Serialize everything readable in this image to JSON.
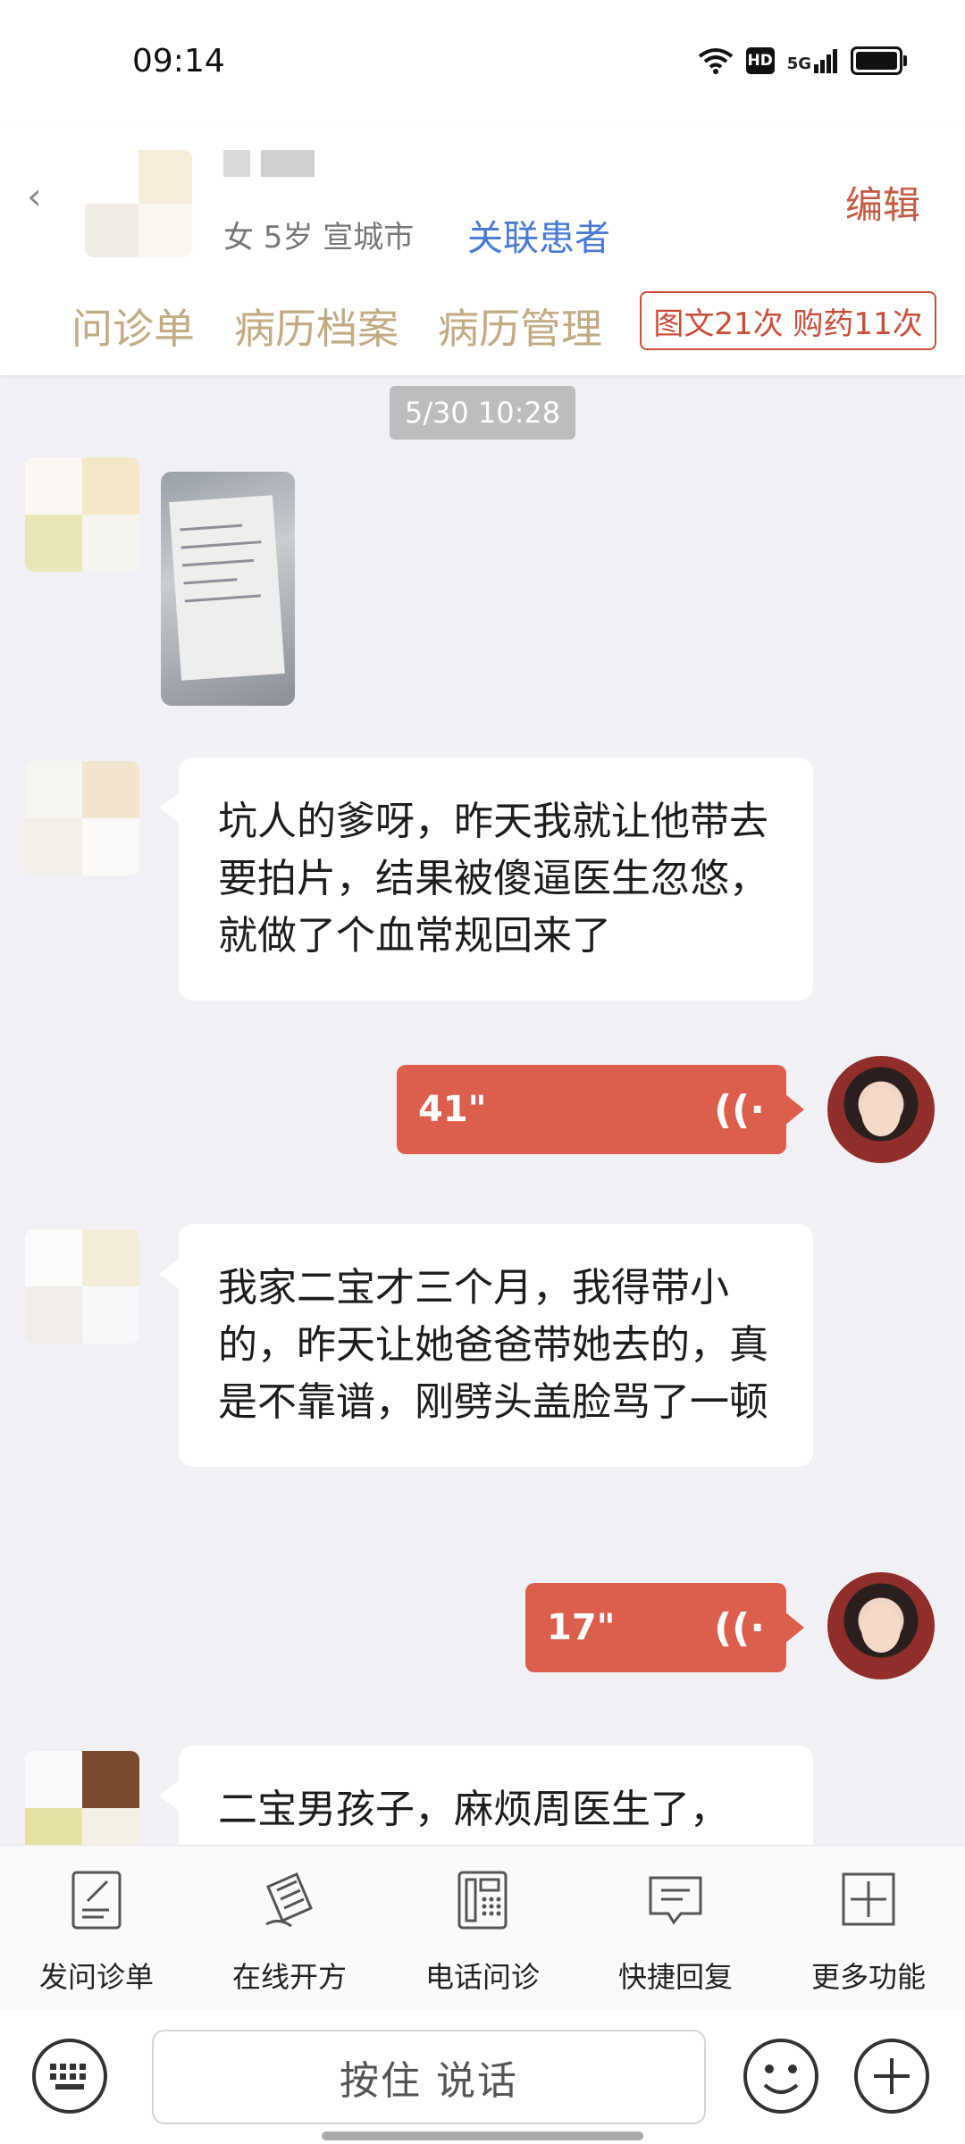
{
  "status_bar": {
    "time": "09:14",
    "hd": "HD",
    "network": "5G"
  },
  "header": {
    "patient_info": "女 5岁  宣城市",
    "link_patient": "关联患者",
    "edit": "编辑",
    "tabs": [
      "问诊单",
      "病历档案",
      "病历管理"
    ],
    "stats": "图文21次 购药11次"
  },
  "chat": {
    "timestamp": "5/30 10:28",
    "messages": [
      {
        "text": "坑人的爹呀，昨天我就让他带去要拍片，结果被傻逼医生忽悠，就做了个血常规回来了"
      },
      {
        "duration": "41\""
      },
      {
        "text": "我家二宝才三个月，我得带小的，昨天让她爸爸带她去的，真是不靠谱，刚劈头盖脸骂了一顿"
      },
      {
        "duration": "17\""
      },
      {
        "text": "二宝男孩子，麻烦周医生了，"
      }
    ]
  },
  "toolbar": {
    "items": [
      {
        "label": "发问诊单",
        "icon": "form-icon"
      },
      {
        "label": "在线开方",
        "icon": "prescription-icon"
      },
      {
        "label": "电话问诊",
        "icon": "phone-icon"
      },
      {
        "label": "快捷回复",
        "icon": "message-icon"
      },
      {
        "label": "更多功能",
        "icon": "plus-square-icon"
      }
    ]
  },
  "input": {
    "talk_label": "按住 说话"
  },
  "colors": {
    "accent": "#db5f4c",
    "tab_text": "#c2ab84",
    "link": "#4a7ad3"
  }
}
